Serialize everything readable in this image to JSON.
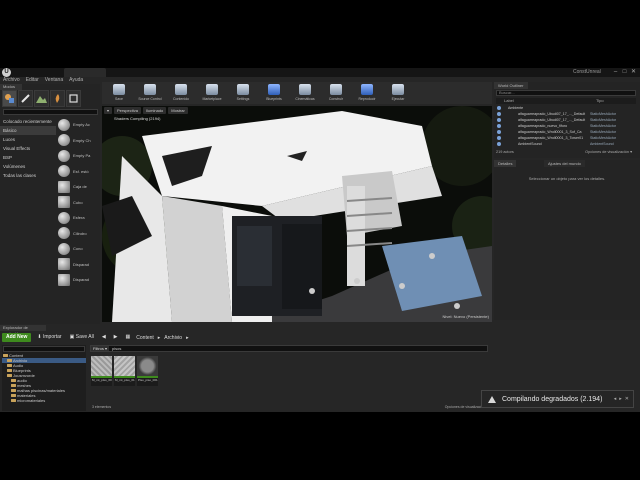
{
  "app": {
    "project_name": "ConstUnreal",
    "logo": "U",
    "window_controls": [
      "–",
      "□",
      "✕"
    ]
  },
  "menu": [
    "Archivo",
    "Editar",
    "Ventana",
    "Ayuda"
  ],
  "modes": {
    "tab": "Modos",
    "icons": [
      "place-icon",
      "paint-icon",
      "landscape-icon",
      "foliage-icon",
      "geometry-icon"
    ],
    "categories": [
      "Colocado recientemente",
      "Básico",
      "Luces",
      "Visual Effects",
      "BSP",
      "Volúmenes",
      "Todas las clases"
    ],
    "selected_category": 1,
    "items": [
      "Empty Ac",
      "Empty Ch",
      "Empty Pa",
      "Esf. estó",
      "Caja de",
      "Cubo",
      "Esfera",
      "Cilindro",
      "Cono",
      "Disparad",
      "Disparad"
    ]
  },
  "toolbar": {
    "items": [
      "Save",
      "Source Control",
      "Contenido",
      "Marketplace",
      "Settings",
      "Blueprints",
      "Cinemáticas",
      "Construir",
      "Reproducir",
      "Ejecutar"
    ]
  },
  "viewport": {
    "buttons": [
      "Perspectiva",
      "Iluminado",
      "Mostrar"
    ],
    "shader_note": "Shaders Compiling (2194)",
    "level_label": "Nivel:  Nuevo (Persistente)"
  },
  "outliner": {
    "tab": "World Outliner",
    "search_placeholder": "Buscar...",
    "col_label": "Label",
    "col_type": "Tipo",
    "rows": [
      {
        "name": "Ambiente",
        "type": ""
      },
      {
        "name": "alfaguarreaprado_Ubudi07_17_..._Default",
        "type": "StaticMeshActor"
      },
      {
        "name": "alfaguarreaprado_Ubudi07_17_..._Default",
        "type": "StaticMeshActor"
      },
      {
        "name": "alfaguarreaprado_nuevo_fiforo",
        "type": "StaticMeshActor"
      },
      {
        "name": "alfaguarreaprado_Wndi0001_3_Sof_Ca",
        "type": "StaticMeshActor"
      },
      {
        "name": "alfaguarreaprado_Wndi0001_3_Tower01",
        "type": "StaticMeshActor"
      },
      {
        "name": "alfaguarreaprado_Wndi0001_3_Tower01",
        "type": "StaticMeshActor"
      },
      {
        "name": "AmbientSound",
        "type": "AmbientSound"
      }
    ],
    "footer_count": "219 actors",
    "footer_options": "Opciones de visualización ▾"
  },
  "details": {
    "tab_details": "Detalles",
    "tab_world": "Ajustes del mundo",
    "empty_message": "Seleccionar un objeto para ver los detalles."
  },
  "content_browser": {
    "tab": "Explorador de contenido",
    "add_new": "Add New",
    "import": "Importar",
    "save_all": "Save All",
    "breadcrumb": [
      "Content",
      "Archivio"
    ],
    "filters": "Filtros ▾",
    "search_text": "pisos",
    "tree": [
      {
        "label": "Content",
        "indent": 0
      },
      {
        "label": "Archivio",
        "indent": 1,
        "selected": true
      },
      {
        "label": "Audio",
        "indent": 1
      },
      {
        "label": "Blueprints",
        "indent": 1
      },
      {
        "label": "Jousmvorde",
        "indent": 1
      },
      {
        "label": "audio",
        "indent": 2
      },
      {
        "label": "meshes",
        "indent": 2
      },
      {
        "label": "malhas piscinas/materiales",
        "indent": 2
      },
      {
        "label": "materiales",
        "indent": 2
      },
      {
        "label": "micromateriales",
        "indent": 2
      }
    ],
    "assets": [
      {
        "label": "M_mt_piso_00"
      },
      {
        "label": "M_mt_piso_01"
      },
      {
        "label": "Piso_piso_001"
      }
    ],
    "item_count": "3 elementos",
    "view_options": "Opciones de visualización ▾"
  },
  "toast": {
    "text": "Compilando degradados (2.194)",
    "controls": [
      "◂",
      "▸",
      "✕"
    ]
  }
}
